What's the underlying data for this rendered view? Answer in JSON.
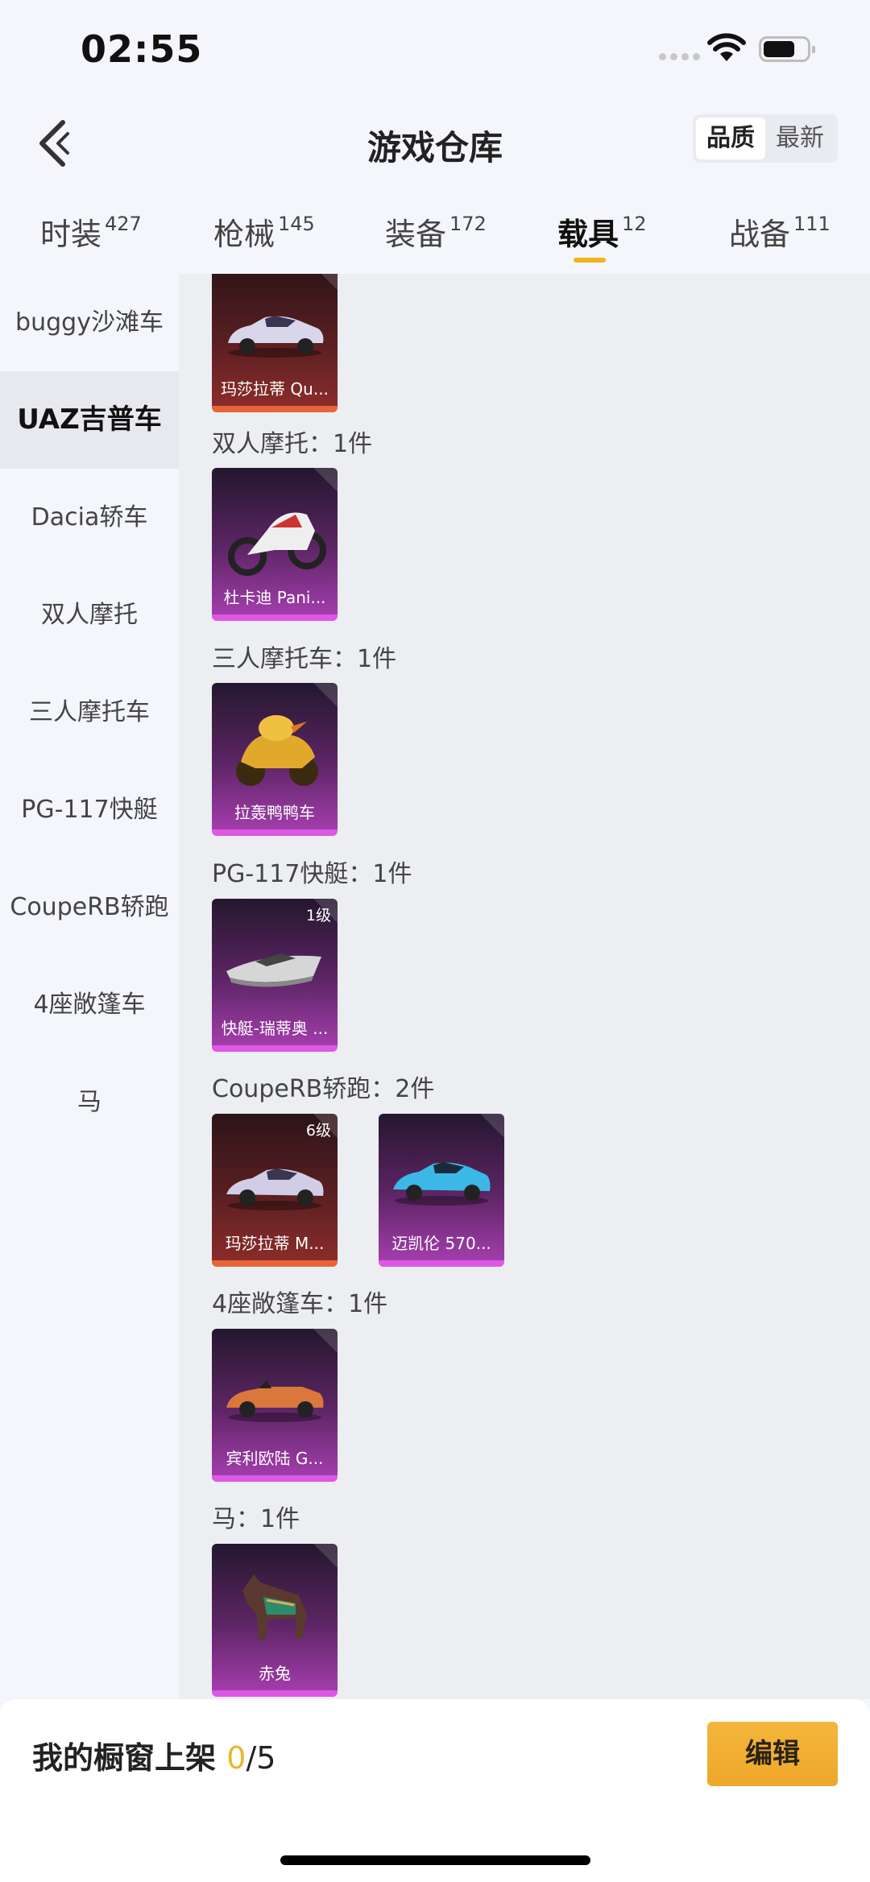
{
  "status_bar": {
    "time": "02:55"
  },
  "header": {
    "title": "游戏仓库",
    "sort_options": [
      "品质",
      "最新"
    ],
    "active_sort": "品质"
  },
  "tabs": [
    {
      "label": "时装",
      "count": "427"
    },
    {
      "label": "枪械",
      "count": "145"
    },
    {
      "label": "装备",
      "count": "172"
    },
    {
      "label": "载具",
      "count": "12",
      "active": true
    },
    {
      "label": "战备",
      "count": "111"
    }
  ],
  "sidebar": {
    "items": [
      "buggy沙滩车",
      "UAZ吉普车",
      "Dacia轿车",
      "双人摩托",
      "三人摩托车",
      "PG-117快艇",
      "CoupeRB轿跑",
      "4座敞篷车",
      "马"
    ],
    "active": "UAZ吉普车"
  },
  "sections": [
    {
      "title": "",
      "cards": [
        {
          "name": "玛莎拉蒂 Qu...",
          "level": "",
          "rarity": "red"
        }
      ]
    },
    {
      "title": "双人摩托：1件",
      "cards": [
        {
          "name": "杜卡迪 Pani...",
          "level": "",
          "rarity": "purple"
        }
      ]
    },
    {
      "title": "三人摩托车：1件",
      "cards": [
        {
          "name": "拉轰鸭鸭车",
          "level": "",
          "rarity": "purple"
        }
      ]
    },
    {
      "title": "PG-117快艇：1件",
      "cards": [
        {
          "name": "快艇-瑞蒂奥 ...",
          "level": "1级",
          "rarity": "purple"
        }
      ]
    },
    {
      "title": "CoupeRB轿跑：2件",
      "cards": [
        {
          "name": "玛莎拉蒂 M...",
          "level": "6级",
          "rarity": "red"
        },
        {
          "name": "迈凯伦 570...",
          "level": "",
          "rarity": "purple"
        }
      ]
    },
    {
      "title": "4座敞篷车：1件",
      "cards": [
        {
          "name": "宾利欧陆 G...",
          "level": "",
          "rarity": "purple"
        }
      ]
    },
    {
      "title": "马：1件",
      "cards": [
        {
          "name": "赤兔",
          "level": "",
          "rarity": "purple"
        }
      ]
    }
  ],
  "bottom_bar": {
    "shelf_label": "我的橱窗上架",
    "shelf_count": "0",
    "shelf_total": "/5",
    "edit_label": "编辑"
  },
  "colors": {
    "accent": "#f3b41b",
    "button": "#f0b030",
    "rarity_red": "#e7643a",
    "rarity_purple": "#dd58e4"
  }
}
